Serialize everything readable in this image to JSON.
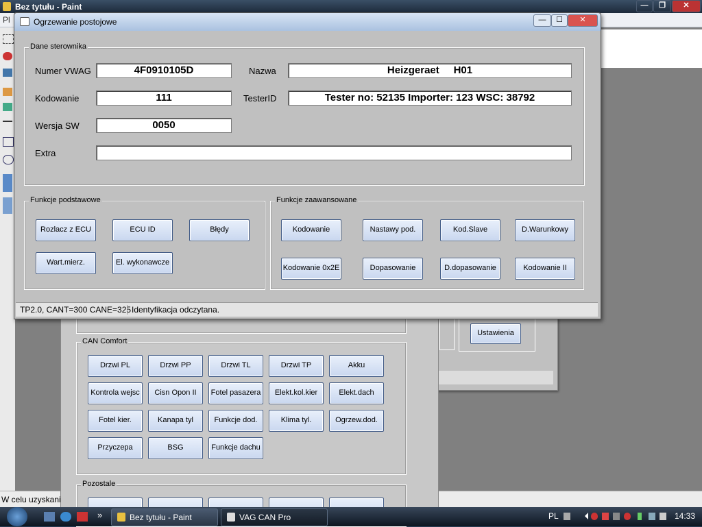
{
  "paint": {
    "title": "Bez tytułu - Paint",
    "menu_fragment": "Pl",
    "status_text": "W celu uzyskani",
    "controls": {
      "min": "—",
      "max": "❐",
      "close": "✕"
    }
  },
  "dialog": {
    "title": "Ogrzewanie postojowe",
    "controls": {
      "min": "—",
      "max": "☐",
      "close": "✕"
    },
    "dane": {
      "group_label": "Dane sterownika",
      "numer_label": "Numer VWAG",
      "numer_value": "4F0910105D",
      "nazwa_label": "Nazwa",
      "nazwa_value": "Heizgeraet     H01",
      "kodowanie_label": "Kodowanie",
      "kodowanie_value": "111",
      "testerid_label": "TesterID",
      "testerid_value": "Tester no: 52135 Importer: 123 WSC: 38792",
      "wersja_label": "Wersja SW",
      "wersja_value": "0050",
      "extra_label": "Extra",
      "extra_value": ""
    },
    "basic": {
      "group_label": "Funkcje podstawowe",
      "buttons": [
        "Rozlacz z ECU",
        "ECU ID",
        "Błędy",
        "Wart.mierz.",
        "El. wykonawcze"
      ]
    },
    "advanced": {
      "group_label": "Funkcje zaawansowane",
      "buttons": [
        "Kodowanie",
        "Nastawy pod.",
        "Kod.Slave",
        "D.Warunkowy",
        "Kodowanie 0x2E",
        "Dopasowanie",
        "D.dopasowanie",
        "Kodowanie II"
      ]
    },
    "status": {
      "left": "TP2.0, CANT=300 CANE=325",
      "right": "Identyfikacja odczytana."
    }
  },
  "main_window": {
    "can_comfort_label": "CAN Comfort",
    "can_comfort_buttons": [
      "Drzwi PL",
      "Drzwi PP",
      "Drzwi TL",
      "Drzwi TP",
      "Akku",
      "Kontrola wejsc",
      "Cisn Opon II",
      "Fotel pasazera",
      "Elekt.kol.kier",
      "Elekt.dach",
      "Fotel kier.",
      "Kanapa tyl",
      "Funkcje dod.",
      "Klima tyl.",
      "Ogrzew.dod.",
      "Przyczepa",
      "BSG",
      "Funkcje dachu"
    ],
    "pozostale_label": "Pozostale",
    "ustawienia": "Ustawienia"
  },
  "taskbar": {
    "tasks": [
      "Bez tytułu - Paint",
      "VAG CAN Pro"
    ],
    "lang": "PL",
    "clock": "14:33",
    "more": "»"
  }
}
